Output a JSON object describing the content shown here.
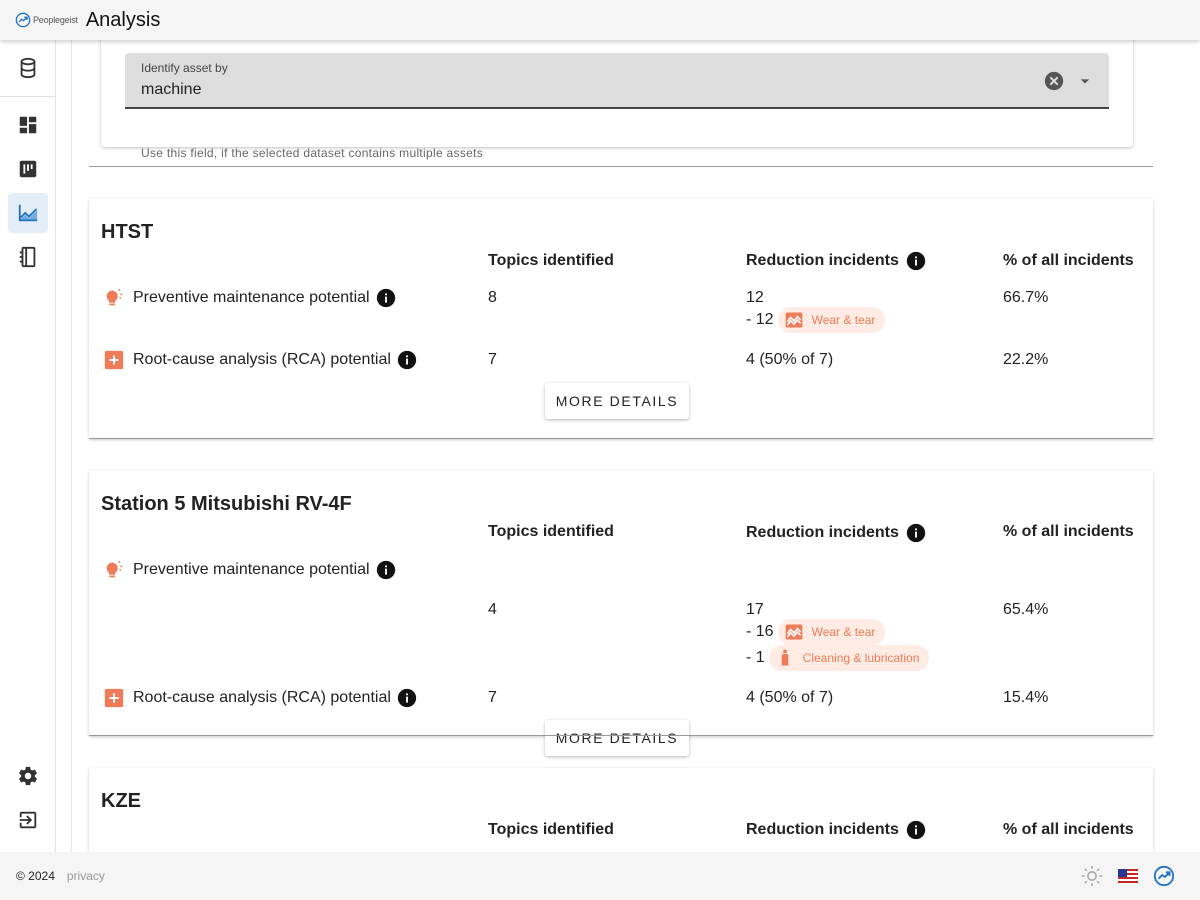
{
  "header": {
    "brand": "Peoplegeist",
    "title": "Analysis"
  },
  "sidebar": {
    "items": [
      {
        "icon": "database-icon"
      },
      {
        "icon": "dashboard-icon"
      },
      {
        "icon": "board-icon"
      },
      {
        "icon": "analysis-chart-icon",
        "active": true
      },
      {
        "icon": "notebook-icon"
      }
    ],
    "bottom": [
      {
        "icon": "gear-icon"
      },
      {
        "icon": "logout-icon"
      }
    ]
  },
  "asset_select": {
    "label": "Identify asset by",
    "value": "machine",
    "hint": "Use this field, if the selected dataset contains multiple assets"
  },
  "columns": {
    "topics": "Topics identified",
    "reduction": "Reduction incidents",
    "percent": "% of all incidents"
  },
  "assets": [
    {
      "name": "HTST",
      "pm": {
        "label": "Preventive maintenance potential",
        "topics": "8",
        "reduction": "12",
        "sub": [
          {
            "count": "- 12",
            "tag": "Wear & tear",
            "icon": "wave-chart-icon"
          }
        ],
        "percent": "66.7%"
      },
      "rca": {
        "label": "Root-cause analysis (RCA) potential",
        "topics": "7",
        "reduction": "4 (50% of 7)",
        "percent": "22.2%"
      },
      "button": "MORE DETAILS"
    },
    {
      "name": "Station 5 Mitsubishi RV-4F",
      "pm": {
        "label": "Preventive maintenance potential",
        "topics": "4",
        "reduction": "17",
        "sub": [
          {
            "count": "- 16",
            "tag": "Wear & tear",
            "icon": "wave-chart-icon"
          },
          {
            "count": "- 1",
            "tag": "Cleaning & lubrication",
            "icon": "oil-bottle-icon"
          }
        ],
        "percent": "65.4%"
      },
      "rca": {
        "label": "Root-cause analysis (RCA) potential",
        "topics": "7",
        "reduction": "4 (50% of 7)",
        "percent": "15.4%"
      },
      "button": "MORE DETAILS"
    },
    {
      "name": "KZE"
    }
  ],
  "footer": {
    "copyright": "© 2024",
    "privacy": "privacy"
  },
  "colors": {
    "accent": "#1f72c4",
    "orange": "#ef7b58",
    "chip_bg": "#fdebe4"
  }
}
